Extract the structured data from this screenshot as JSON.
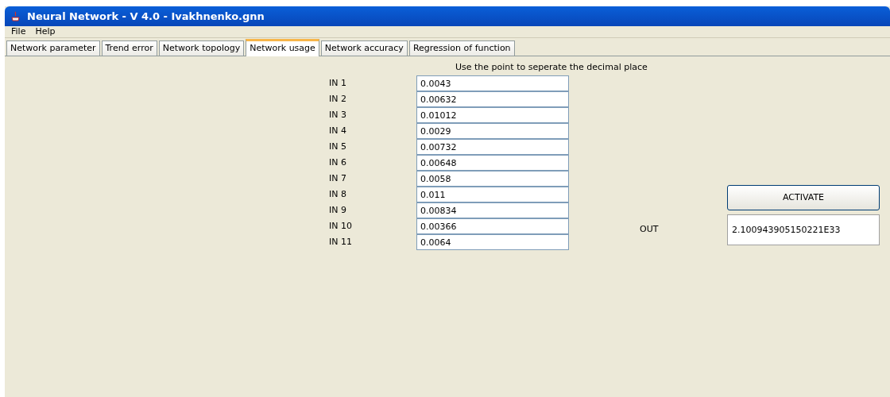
{
  "window": {
    "title": "Neural Network - V 4.0 - Ivakhnenko.gnn"
  },
  "menu": [
    "File",
    "Help"
  ],
  "tabs": [
    {
      "label": "Network parameter",
      "selected": false
    },
    {
      "label": "Trend error",
      "selected": false
    },
    {
      "label": "Network topology",
      "selected": false
    },
    {
      "label": "Network usage",
      "selected": true
    },
    {
      "label": "Network accuracy",
      "selected": false
    },
    {
      "label": "Regression of function",
      "selected": false
    }
  ],
  "hint": "Use the point to seperate the decimal place",
  "inputs": [
    {
      "label": "IN 1",
      "value": "0.0043"
    },
    {
      "label": "IN 2",
      "value": "0.00632"
    },
    {
      "label": "IN 3",
      "value": "0.01012"
    },
    {
      "label": "IN 4",
      "value": "0.0029"
    },
    {
      "label": "IN 5",
      "value": "0.00732"
    },
    {
      "label": "IN 6",
      "value": "0.00648"
    },
    {
      "label": "IN 7",
      "value": "0.0058"
    },
    {
      "label": "IN 8",
      "value": "0.011"
    },
    {
      "label": "IN 9",
      "value": "0.00834"
    },
    {
      "label": "IN 10",
      "value": "0.00366"
    },
    {
      "label": "IN 11",
      "value": "0.0064"
    }
  ],
  "activate_button": "ACTIVATE",
  "output": {
    "label": "OUT",
    "value": "2.100943905150221E33"
  }
}
